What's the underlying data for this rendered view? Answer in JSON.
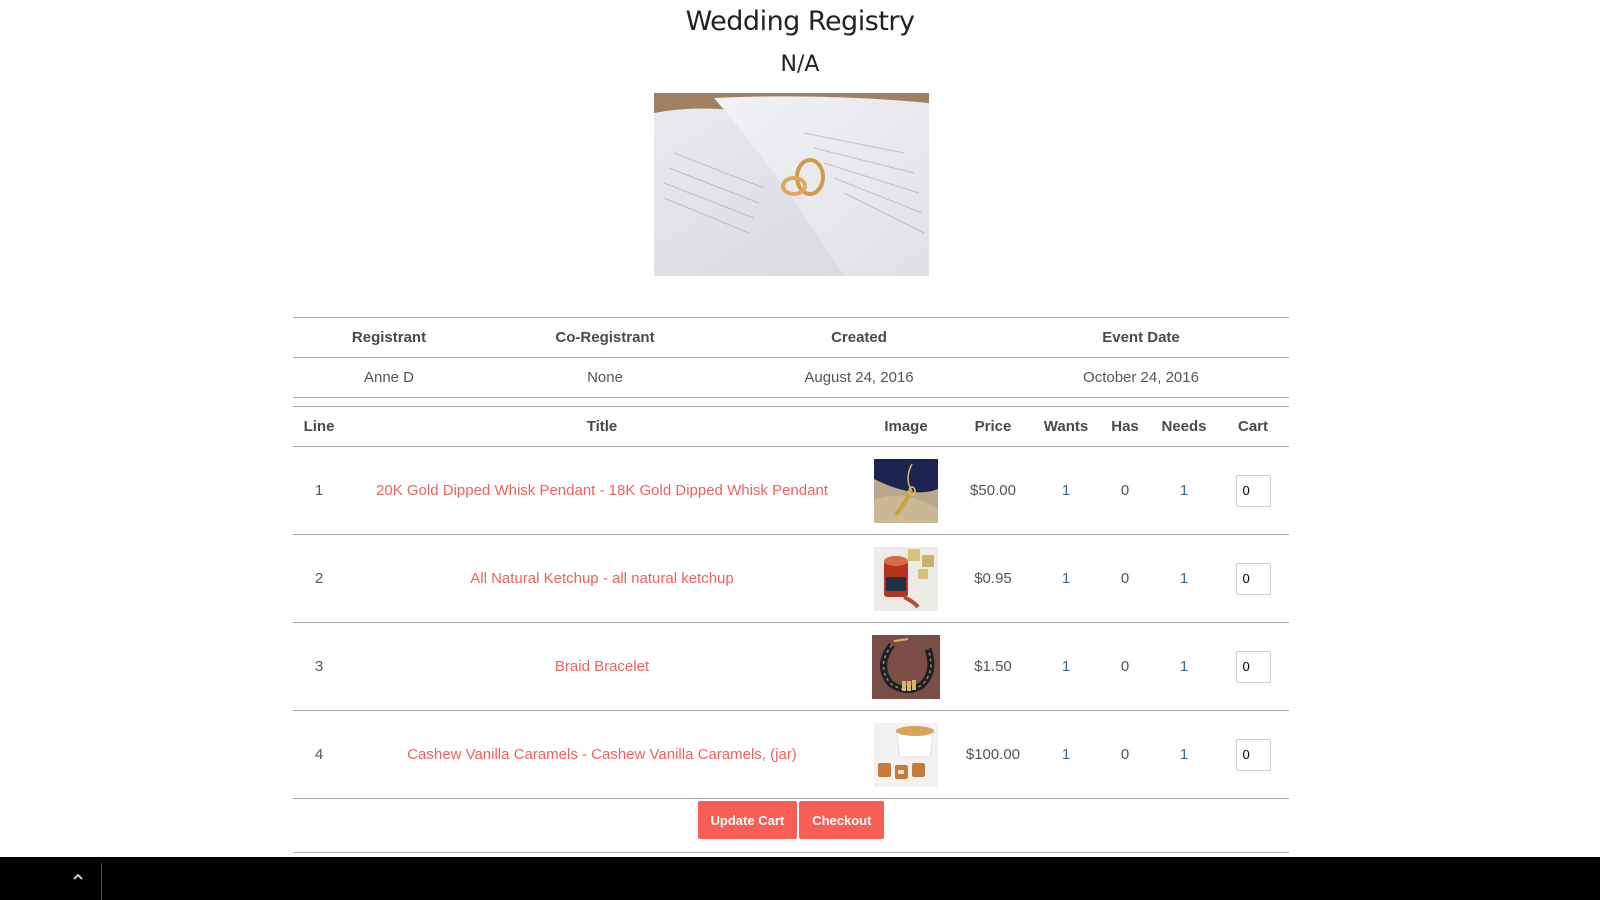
{
  "header": {
    "title": "Wedding Registry",
    "subtitle": "N/A",
    "hero_image": "wedding-rings-on-book-image"
  },
  "registry_info": {
    "columns": [
      "Registrant",
      "Co-Registrant",
      "Created",
      "Event Date"
    ],
    "values": [
      "Anne D",
      "None",
      "August 24, 2016",
      "October 24, 2016"
    ]
  },
  "items": {
    "columns": [
      "Line",
      "Title",
      "Image",
      "Price",
      "Wants",
      "Has",
      "Needs",
      "Cart"
    ],
    "rows": [
      {
        "line": "1",
        "title": "20K Gold Dipped Whisk Pendant - 18K Gold Dipped Whisk Pendant",
        "image": "whisk-pendant-image",
        "price": "$50.00",
        "wants": "1",
        "has": "0",
        "needs": "1",
        "cart": "0"
      },
      {
        "line": "2",
        "title": "All Natural Ketchup - all natural ketchup",
        "image": "ketchup-jar-image",
        "price": "$0.95",
        "wants": "1",
        "has": "0",
        "needs": "1",
        "cart": "0"
      },
      {
        "line": "3",
        "title": "Braid Bracelet",
        "image": "braid-bracelet-image",
        "price": "$1.50",
        "wants": "1",
        "has": "0",
        "needs": "1",
        "cart": "0"
      },
      {
        "line": "4",
        "title": "Cashew Vanilla Caramels - Cashew Vanilla Caramels, (jar)",
        "image": "cashew-caramels-image",
        "price": "$100.00",
        "wants": "1",
        "has": "0",
        "needs": "1",
        "cart": "0"
      }
    ]
  },
  "actions": {
    "update_cart": "Update Cart",
    "checkout": "Checkout"
  },
  "footer": {
    "scroll_top_icon": "chevron-up-icon"
  },
  "colors": {
    "accent": "#f65e56",
    "link": "#f0625a",
    "number": "#3d6a8c"
  }
}
